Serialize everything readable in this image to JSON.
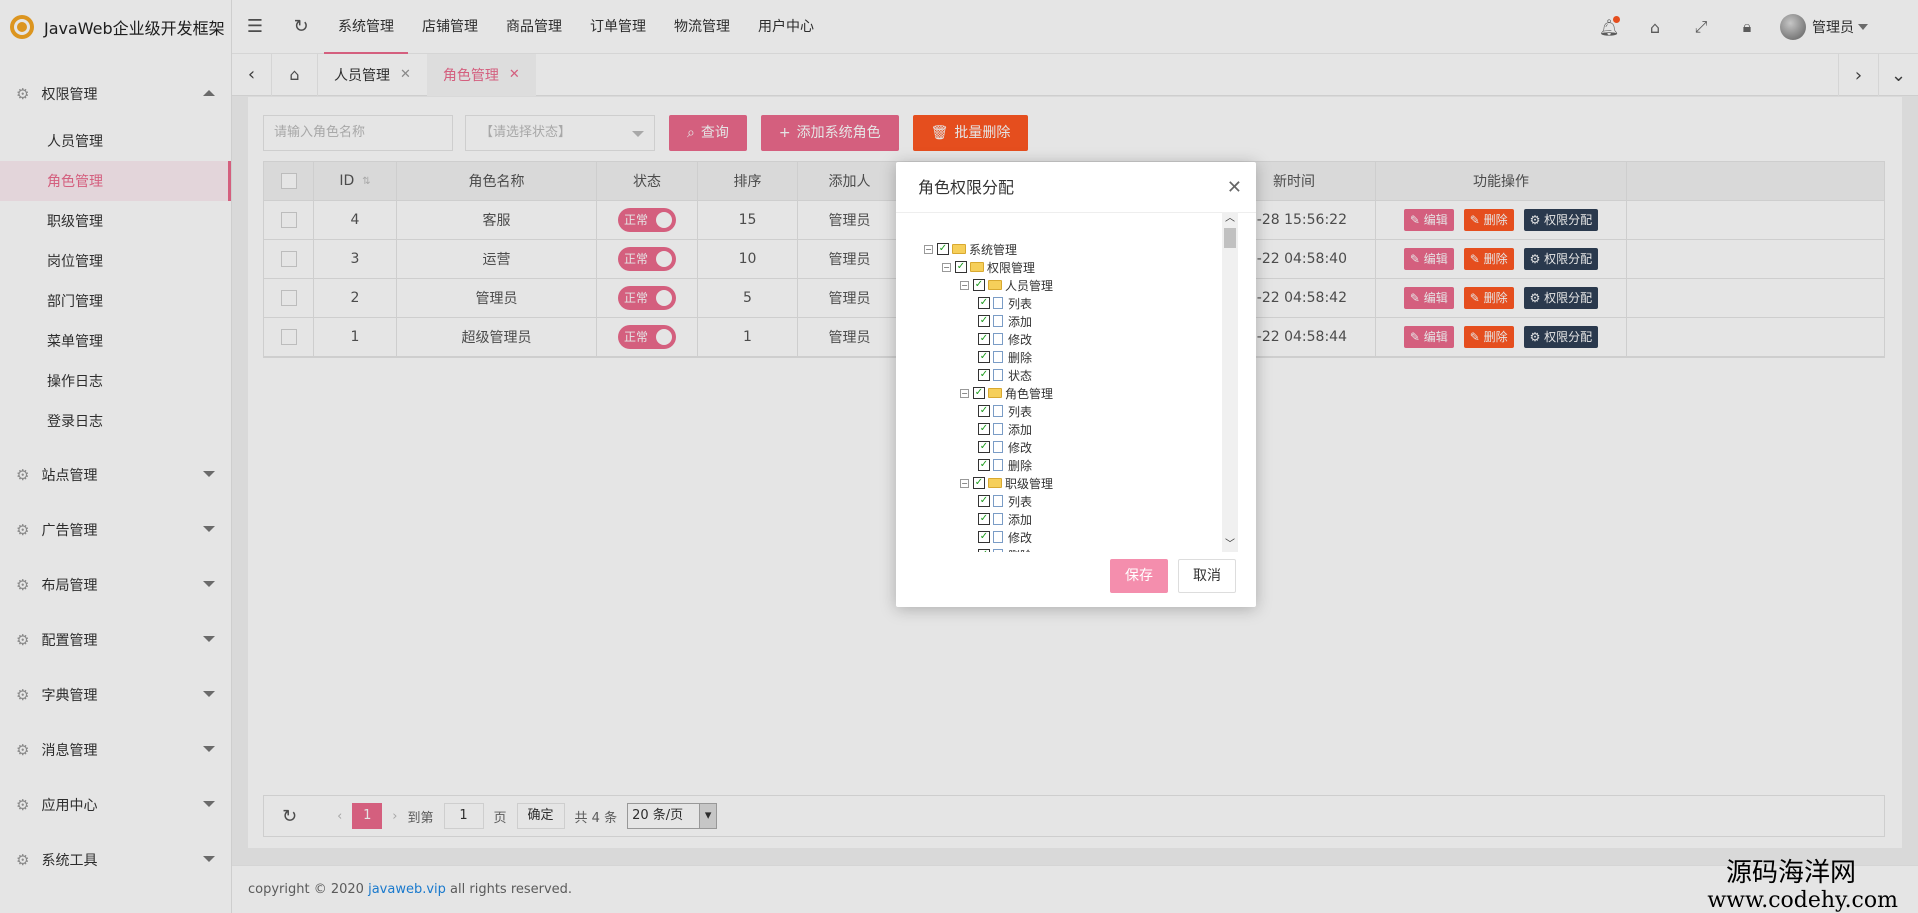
{
  "app": {
    "title": "JavaWeb企业级开发框架"
  },
  "sidebar": {
    "groups": [
      {
        "label": "权限管理",
        "expanded": true
      },
      {
        "label": "站点管理"
      },
      {
        "label": "广告管理"
      },
      {
        "label": "布局管理"
      },
      {
        "label": "配置管理"
      },
      {
        "label": "字典管理"
      },
      {
        "label": "消息管理"
      },
      {
        "label": "应用中心"
      },
      {
        "label": "系统工具"
      }
    ],
    "items": [
      "人员管理",
      "角色管理",
      "职级管理",
      "岗位管理",
      "部门管理",
      "菜单管理",
      "操作日志",
      "登录日志"
    ]
  },
  "header": {
    "menu": [
      "系统管理",
      "店铺管理",
      "商品管理",
      "订单管理",
      "物流管理",
      "用户中心"
    ],
    "user": "管理员"
  },
  "tabs": [
    {
      "label": "人员管理"
    },
    {
      "label": "角色管理"
    }
  ],
  "toolbar": {
    "search_placeholder": "请输入角色名称",
    "status_placeholder": "【请选择状态】",
    "query": "查询",
    "add": "添加系统角色",
    "batch_delete": "批量删除"
  },
  "table": {
    "headers": [
      "ID",
      "角色名称",
      "状态",
      "排序",
      "添加人",
      "新时间",
      "功能操作"
    ],
    "rows": [
      {
        "id": "4",
        "name": "客服",
        "status": "正常",
        "sort": "15",
        "creator": "管理员",
        "time": "-28 15:56:22"
      },
      {
        "id": "3",
        "name": "运营",
        "status": "正常",
        "sort": "10",
        "creator": "管理员",
        "time": "-22 04:58:40"
      },
      {
        "id": "2",
        "name": "管理员",
        "status": "正常",
        "sort": "5",
        "creator": "管理员",
        "time": "-22 04:58:42"
      },
      {
        "id": "1",
        "name": "超级管理员",
        "status": "正常",
        "sort": "1",
        "creator": "管理员",
        "time": "-22 04:58:44"
      }
    ],
    "ops": {
      "edit": "编辑",
      "delete": "删除",
      "perm": "权限分配"
    }
  },
  "pager": {
    "current": "1",
    "goto": "到第",
    "page_value": "1",
    "page_unit": "页",
    "confirm": "确定",
    "total": "共 4 条",
    "size": "20 条/页"
  },
  "modal": {
    "title": "角色权限分配",
    "tree": {
      "root": "系统管理",
      "l1": "权限管理",
      "person": "人员管理",
      "person_children": [
        "列表",
        "添加",
        "修改",
        "删除",
        "状态"
      ],
      "role": "角色管理",
      "role_children": [
        "列表",
        "添加",
        "修改",
        "删除"
      ],
      "rank": "职级管理",
      "rank_children": [
        "列表",
        "添加",
        "修改",
        "删除"
      ]
    },
    "save": "保存",
    "cancel": "取消"
  },
  "footer": {
    "prefix": "copyright © 2020",
    "link": "javaweb.vip",
    "suffix": "all rights reserved."
  },
  "watermark": {
    "line1": "源码海洋网",
    "line2": "www.codehy.com"
  }
}
